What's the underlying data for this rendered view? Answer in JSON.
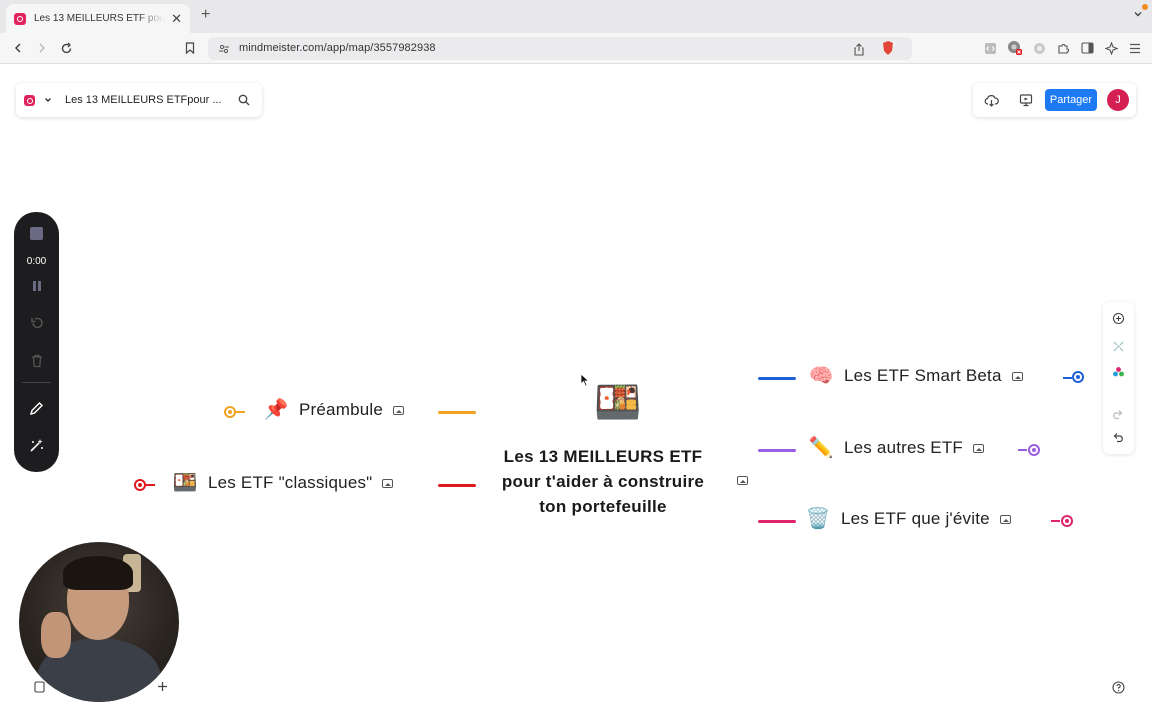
{
  "browser": {
    "tab_title": "Les 13 MEILLEURS ETF pour t'aider à construire ton portefeuille",
    "url": "mindmeister.com/app/map/3557982938",
    "extension_badge": "2"
  },
  "app": {
    "map_title": "Les 13 MEILLEURS ETFpour ...",
    "share_label": "Partager",
    "avatar_initial": "J",
    "accent_color": "#1d7af3"
  },
  "recorder": {
    "time": "0:00"
  },
  "mindmap": {
    "center": {
      "emoji": "🍱",
      "lines": [
        "Les 13 MEILLEURS ETF",
        "pour t'aider à construire",
        "ton portefeuille"
      ]
    },
    "left_nodes": [
      {
        "emoji": "📌",
        "label": "Préambule",
        "color": "#f0a323"
      },
      {
        "emoji": "🍱",
        "label": "Les ETF \"classiques\"",
        "color": "#e0181e"
      }
    ],
    "right_nodes": [
      {
        "emoji": "🧠",
        "label": "Les ETF Smart Beta",
        "color": "#1f5fd8"
      },
      {
        "emoji": "✏️",
        "label": "Les autres ETF",
        "color": "#9b5de5"
      },
      {
        "emoji": "🗑️",
        "label": "Les ETF que j'évite",
        "color": "#e0246e"
      }
    ]
  }
}
